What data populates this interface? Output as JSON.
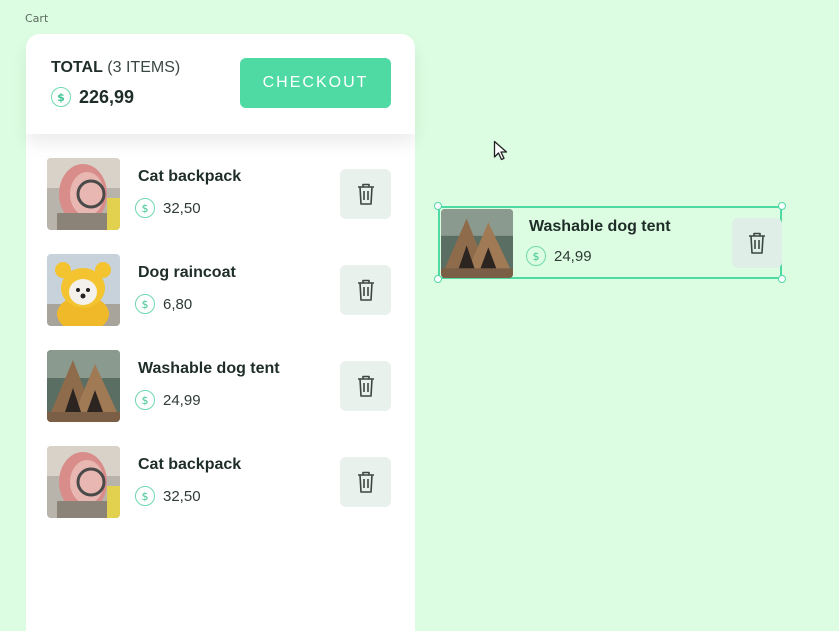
{
  "frame_label": "Cart",
  "header": {
    "total_label": "TOTAL",
    "items_count": "(3 ITEMS)",
    "total_amount": "226,99",
    "checkout_label": "CHECKOUT"
  },
  "currency_symbol": "$",
  "items": [
    {
      "name": "Cat backpack",
      "price": "32,50",
      "image": "cat-backpack-photo"
    },
    {
      "name": "Dog raincoat",
      "price": "6,80",
      "image": "dog-raincoat-photo"
    },
    {
      "name": "Washable dog tent",
      "price": "24,99",
      "image": "dog-tent-photo"
    },
    {
      "name": "Cat backpack",
      "price": "32,50",
      "image": "cat-backpack-photo"
    }
  ],
  "dragged_item": {
    "name": "Washable dog tent",
    "price": "24,99",
    "image": "dog-tent-photo"
  },
  "colors": {
    "background": "#dcfde1",
    "accent": "#4fdaa3",
    "text": "#1f2d28",
    "trash_bg": "#e8f1ec"
  }
}
